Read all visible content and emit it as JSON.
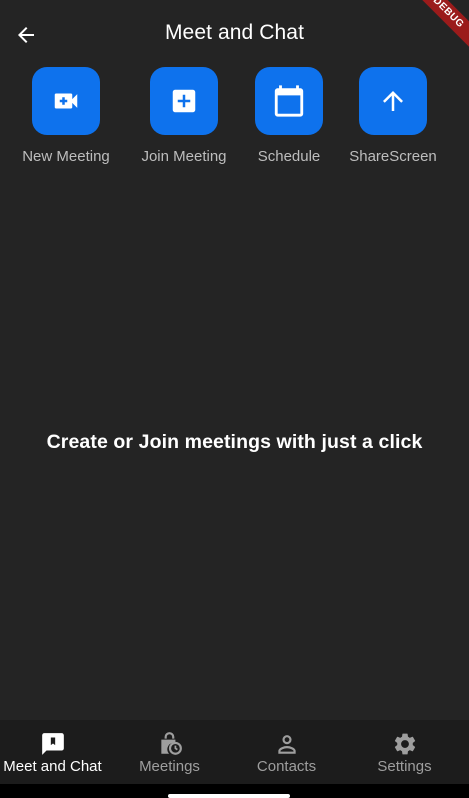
{
  "app_bar": {
    "title": "Meet and Chat",
    "back_icon": "arrow-back-icon",
    "debug_banner": "DEBUG"
  },
  "actions": [
    {
      "label": "New Meeting",
      "icon": "videocam-icon"
    },
    {
      "label": "Join Meeting",
      "icon": "add-box-icon"
    },
    {
      "label": "Schedule",
      "icon": "calendar-icon"
    },
    {
      "label": "ShareScreen",
      "icon": "arrow-up-icon"
    }
  ],
  "main": {
    "message": "Create or Join meetings with just a click"
  },
  "bottom_nav": {
    "items": [
      {
        "label": "Meet and Chat",
        "icon": "chat-bubble-icon",
        "active": true
      },
      {
        "label": "Meetings",
        "icon": "lock-clock-icon",
        "active": false
      },
      {
        "label": "Contacts",
        "icon": "person-icon",
        "active": false
      },
      {
        "label": "Settings",
        "icon": "gear-icon",
        "active": false
      }
    ]
  },
  "colors": {
    "background": "#242424",
    "accent": "#0e72ed",
    "nav_background": "#1c1c1c",
    "inactive_text": "#9e9e9e",
    "label_text": "#bdbdbd",
    "debug_ribbon": "#9b1b1b"
  }
}
